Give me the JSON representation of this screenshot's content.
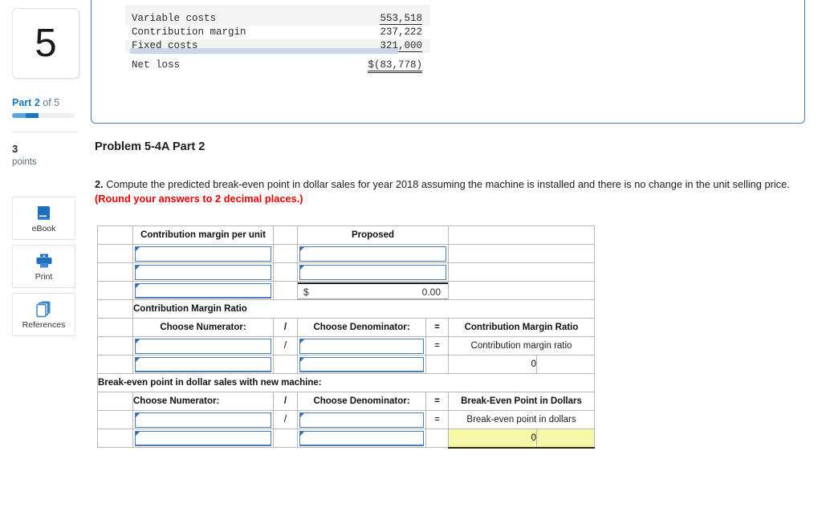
{
  "sidebar": {
    "question_number": "5",
    "part_prefix": "Part",
    "part_current": "2",
    "part_of": "of",
    "part_total": "5",
    "points_value": "3",
    "points_label": "points",
    "tools": [
      {
        "name": "ebook",
        "label": "eBook",
        "icon": "book-icon"
      },
      {
        "name": "print",
        "label": "Print",
        "icon": "printer-icon"
      },
      {
        "name": "references",
        "label": "References",
        "icon": "copy-pages-icon"
      }
    ],
    "accent_color": "#1878c4",
    "progress_track_color": "#efefef"
  },
  "income_statement": {
    "rows": [
      {
        "label": "",
        "value": "",
        "clipped": true,
        "shaded": false
      },
      {
        "label": "Variable costs",
        "value": "553,518",
        "underline": "single",
        "shaded": true
      },
      {
        "label": "Contribution margin",
        "value": "237,222",
        "underline": "none",
        "shaded": false
      },
      {
        "label": "Fixed costs",
        "value": "321,000",
        "underline": "single",
        "shaded": true
      },
      {
        "label": "Net loss",
        "value": "$(83,778)",
        "underline": "double",
        "shaded": false
      }
    ]
  },
  "problem": {
    "title": "Problem 5-4A Part 2",
    "number": "2.",
    "text": "Compute the predicted break-even point in dollar sales for year 2018 assuming the machine is installed and there is no change in the unit selling price.",
    "note": "(Round your answers to 2 decimal places.)",
    "note_color": "#ee0000"
  },
  "answer_table": {
    "header_color": "#6fa8dc",
    "highlight_color": "#f7f7a8",
    "section1": {
      "header_label": "Contribution margin per unit",
      "header_proposed": "Proposed",
      "rows": [
        {
          "type": "input"
        },
        {
          "type": "input"
        },
        {
          "type": "input_total",
          "currency": "$",
          "amount": "0.00"
        }
      ]
    },
    "section2": {
      "title": "Contribution Margin Ratio",
      "col_numerator": "Choose Numerator:",
      "col_slash": "/",
      "col_denominator": "Choose Denominator:",
      "col_equals": "=",
      "col_result": "Contribution Margin Ratio",
      "row1_slash": "/",
      "row1_equals": "=",
      "row1_result_label": "Contribution margin ratio",
      "row2_result_value": "0"
    },
    "section3": {
      "title": "Break-even point in dollar sales with new machine:",
      "col_numerator": "Choose Numerator:",
      "col_slash": "/",
      "col_denominator": "Choose Denominator:",
      "col_equals": "=",
      "col_result": "Break-Even Point in Dollars",
      "row1_slash": "/",
      "row1_equals": "=",
      "row1_result_label": "Break-even point in dollars",
      "row2_result_value": "0"
    }
  }
}
